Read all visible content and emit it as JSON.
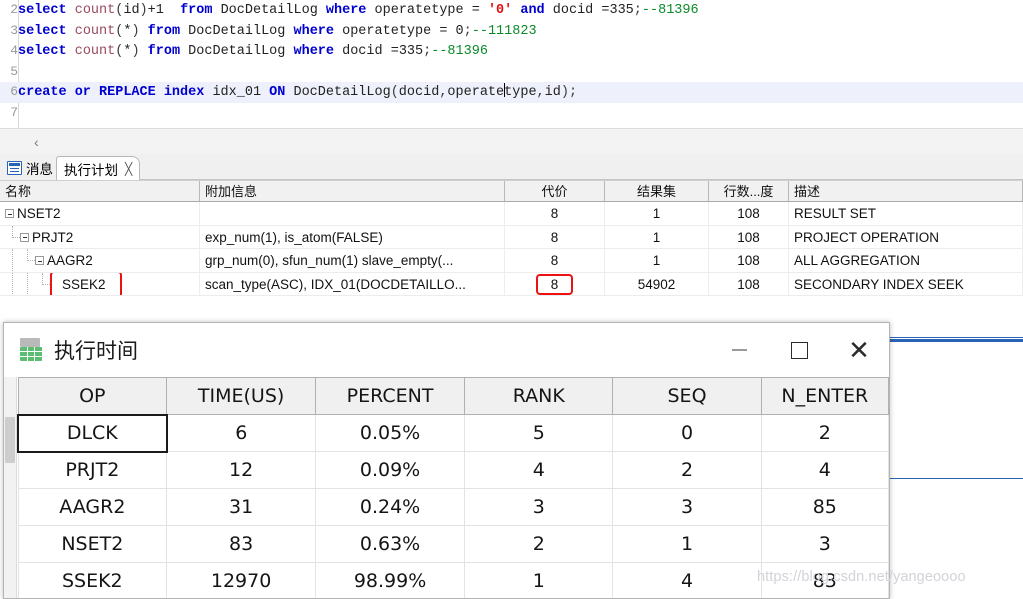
{
  "editor": {
    "lines": [
      {
        "num": "2",
        "highlighted": false,
        "tokens": [
          {
            "t": "select ",
            "c": "kw"
          },
          {
            "t": "count",
            "c": "fn"
          },
          {
            "t": "(",
            "c": "pun"
          },
          {
            "t": "id",
            "c": "pl"
          },
          {
            "t": ")",
            "c": "pun"
          },
          {
            "t": "+1  ",
            "c": "pl"
          },
          {
            "t": "from ",
            "c": "kw"
          },
          {
            "t": "DocDetailLog ",
            "c": "pl"
          },
          {
            "t": "where ",
            "c": "kw"
          },
          {
            "t": "operatetype = ",
            "c": "pl"
          },
          {
            "t": "'0'",
            "c": "str"
          },
          {
            "t": " and ",
            "c": "kw"
          },
          {
            "t": "docid =335",
            "c": "pl"
          },
          {
            "t": ";",
            "c": "pun"
          },
          {
            "t": "--81396",
            "c": "cmt"
          }
        ]
      },
      {
        "num": "3",
        "highlighted": false,
        "tokens": [
          {
            "t": "select ",
            "c": "kw"
          },
          {
            "t": "count",
            "c": "fn"
          },
          {
            "t": "(",
            "c": "pun"
          },
          {
            "t": "*",
            "c": "pl"
          },
          {
            "t": ") ",
            "c": "pun"
          },
          {
            "t": "from ",
            "c": "kw"
          },
          {
            "t": "DocDetailLog ",
            "c": "pl"
          },
          {
            "t": "where ",
            "c": "kw"
          },
          {
            "t": "operatetype = 0",
            "c": "pl"
          },
          {
            "t": ";",
            "c": "pun"
          },
          {
            "t": "--111823",
            "c": "cmt"
          }
        ]
      },
      {
        "num": "4",
        "highlighted": false,
        "tokens": [
          {
            "t": "select ",
            "c": "kw"
          },
          {
            "t": "count",
            "c": "fn"
          },
          {
            "t": "(",
            "c": "pun"
          },
          {
            "t": "*",
            "c": "pl"
          },
          {
            "t": ") ",
            "c": "pun"
          },
          {
            "t": "from ",
            "c": "kw"
          },
          {
            "t": "DocDetailLog ",
            "c": "pl"
          },
          {
            "t": "where ",
            "c": "kw"
          },
          {
            "t": "docid =335",
            "c": "pl"
          },
          {
            "t": ";",
            "c": "pun"
          },
          {
            "t": "--81396",
            "c": "cmt"
          }
        ]
      },
      {
        "num": "5",
        "highlighted": false,
        "tokens": []
      },
      {
        "num": "6",
        "highlighted": true,
        "tokens": [
          {
            "t": "create or REPLACE index ",
            "c": "kw"
          },
          {
            "t": "idx_01 ",
            "c": "pl"
          },
          {
            "t": "ON ",
            "c": "kw"
          },
          {
            "t": "DocDetailLog",
            "c": "pl"
          },
          {
            "t": "(",
            "c": "pun"
          },
          {
            "t": "docid",
            "c": "pl"
          },
          {
            "t": ",",
            "c": "pun"
          },
          {
            "t": "operate",
            "c": "pl"
          },
          {
            "t": "|CARET|",
            "c": "caret"
          },
          {
            "t": "type",
            "c": "pl"
          },
          {
            "t": ",",
            "c": "pun"
          },
          {
            "t": "id",
            "c": "pl"
          },
          {
            "t": ")",
            "c": "pun"
          },
          {
            "t": ";",
            "c": "pun"
          }
        ]
      },
      {
        "num": "7",
        "highlighted": false,
        "tokens": []
      }
    ],
    "collapse_arrow": "‹"
  },
  "tabs": {
    "messages": {
      "label": "消息",
      "icon": "message-icon",
      "active": false
    },
    "plan": {
      "label": "执行计划",
      "icon": "plan-icon",
      "active": true,
      "close": "╳"
    }
  },
  "plan_table": {
    "headers": {
      "name": "名称",
      "info": "附加信息",
      "cost": "代价",
      "result": "结果集",
      "rows": "行数...度",
      "desc": "描述"
    },
    "rows": [
      {
        "name": "NSET2",
        "depth": 0,
        "expandable": true,
        "highlight": false,
        "info": "",
        "cost": "8",
        "cost_highlight": false,
        "result": "1",
        "rows": "108",
        "desc": "RESULT SET"
      },
      {
        "name": "PRJT2",
        "depth": 1,
        "expandable": true,
        "highlight": false,
        "info": "exp_num(1), is_atom(FALSE)",
        "cost": "8",
        "cost_highlight": false,
        "result": "1",
        "rows": "108",
        "desc": "PROJECT OPERATION"
      },
      {
        "name": "AAGR2",
        "depth": 2,
        "expandable": true,
        "highlight": false,
        "info": "grp_num(0), sfun_num(1) slave_empty(...",
        "cost": "8",
        "cost_highlight": false,
        "result": "1",
        "rows": "108",
        "desc": "ALL AGGREGATION"
      },
      {
        "name": "SSEK2",
        "depth": 3,
        "expandable": false,
        "highlight": true,
        "info": "scan_type(ASC), IDX_01(DOCDETAILLO...",
        "cost": "8",
        "cost_highlight": true,
        "result": "54902",
        "rows": "108",
        "desc": "SECONDARY INDEX SEEK"
      }
    ]
  },
  "dialog": {
    "title": "执行时间",
    "icon": "spreadsheet-icon",
    "buttons": {
      "minimize": "—",
      "maximize": "□",
      "close": "✕"
    },
    "grid": {
      "headers": [
        "OP",
        "TIME(US)",
        "PERCENT",
        "RANK",
        "SEQ",
        "N_ENTER"
      ],
      "rows": [
        {
          "op": "DLCK",
          "time": "6",
          "percent": "0.05%",
          "rank": "5",
          "seq": "0",
          "n_enter": "2",
          "selected": true
        },
        {
          "op": "PRJT2",
          "time": "12",
          "percent": "0.09%",
          "rank": "4",
          "seq": "2",
          "n_enter": "4",
          "selected": false
        },
        {
          "op": "AAGR2",
          "time": "31",
          "percent": "0.24%",
          "rank": "3",
          "seq": "3",
          "n_enter": "85",
          "selected": false
        },
        {
          "op": "NSET2",
          "time": "83",
          "percent": "0.63%",
          "rank": "2",
          "seq": "1",
          "n_enter": "3",
          "selected": false
        },
        {
          "op": "SSEK2",
          "time": "12970",
          "percent": "98.99%",
          "rank": "1",
          "seq": "4",
          "n_enter": "83",
          "selected": false
        }
      ]
    }
  },
  "watermark": "https://blog.csdn.net/yangeoooo"
}
